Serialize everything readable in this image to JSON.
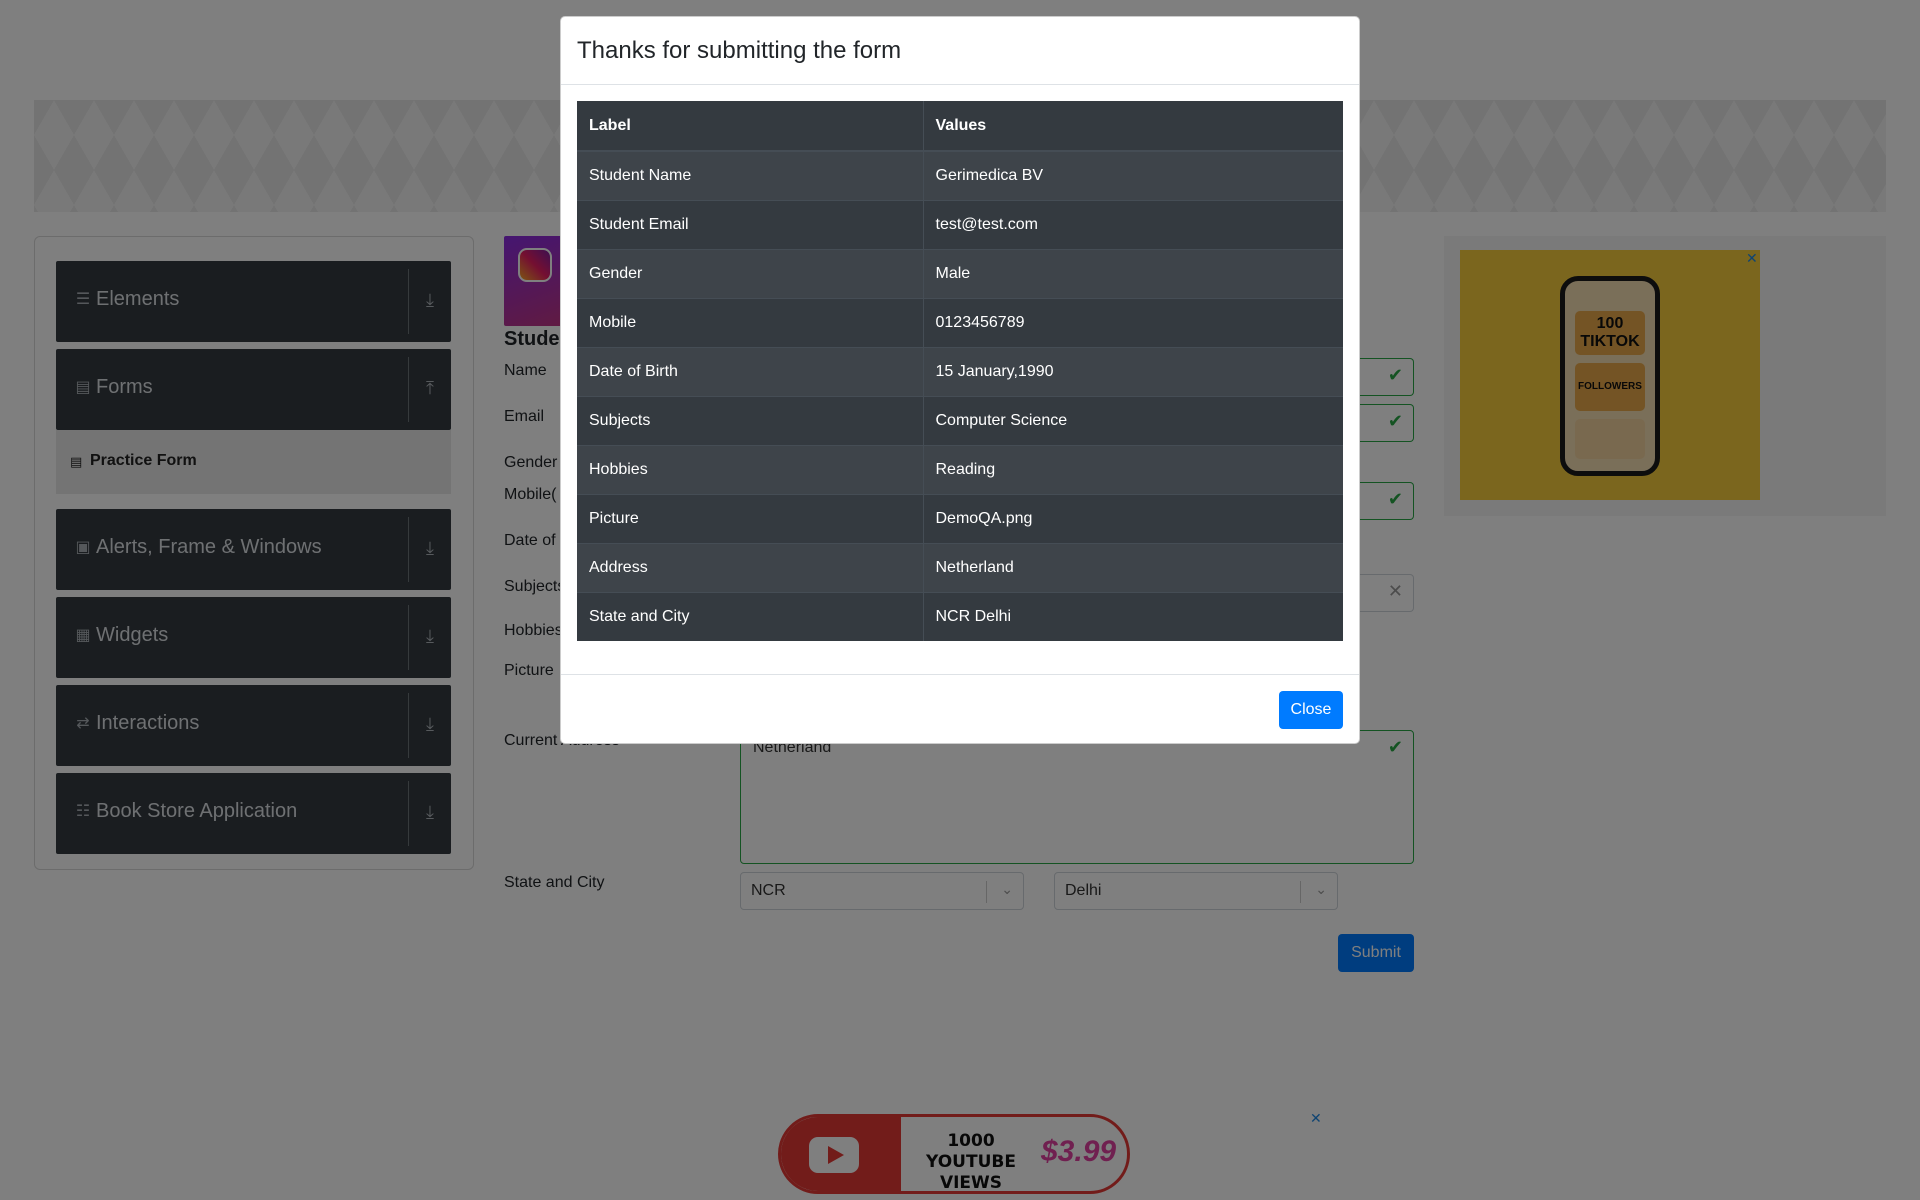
{
  "sidebar": {
    "groups": [
      {
        "label": "Elements",
        "icon": "list-icon",
        "arrow": "download-icon"
      },
      {
        "label": "Forms",
        "icon": "form-icon",
        "arrow": "upload-icon"
      },
      {
        "label": "Alerts, Frame & Windows",
        "icon": "window-icon",
        "arrow": "download-icon"
      },
      {
        "label": "Widgets",
        "icon": "widgets-icon",
        "arrow": "download-icon"
      },
      {
        "label": "Interactions",
        "icon": "interactions-icon",
        "arrow": "download-icon"
      },
      {
        "label": "Book Store Application",
        "icon": "books-icon",
        "arrow": "download-icon"
      }
    ],
    "active_item": "Practice Form"
  },
  "form": {
    "title_partial": "Studen",
    "labels": {
      "name": "Name",
      "email": "Email",
      "gender": "Gender",
      "mobile": "Mobile(",
      "dob": "Date of",
      "subjects": "Subjects",
      "hobbies": "Hobbies",
      "picture": "Picture",
      "address": "Current Address",
      "state_city": "State and City"
    },
    "address_value": "Netherland",
    "state_value": "NCR",
    "city_value": "Delhi",
    "submit_label": "Submit"
  },
  "ads": {
    "right": {
      "line1": "100",
      "line2": "TIKTOK",
      "line3": "FOLLOWERS"
    },
    "bottom": {
      "line1": "1000",
      "line2": "YOUTUBE VIEWS",
      "price": "$3.99"
    }
  },
  "modal": {
    "title": "Thanks for submitting the form",
    "headers": {
      "label": "Label",
      "values": "Values"
    },
    "rows": [
      {
        "label": "Student Name",
        "value": "Gerimedica BV"
      },
      {
        "label": "Student Email",
        "value": "test@test.com"
      },
      {
        "label": "Gender",
        "value": "Male"
      },
      {
        "label": "Mobile",
        "value": "0123456789"
      },
      {
        "label": "Date of Birth",
        "value": "15 January,1990"
      },
      {
        "label": "Subjects",
        "value": "Computer Science"
      },
      {
        "label": "Hobbies",
        "value": "Reading"
      },
      {
        "label": "Picture",
        "value": "DemoQA.png"
      },
      {
        "label": "Address",
        "value": "Netherland"
      },
      {
        "label": "State and City",
        "value": "NCR Delhi"
      }
    ],
    "close_label": "Close"
  }
}
